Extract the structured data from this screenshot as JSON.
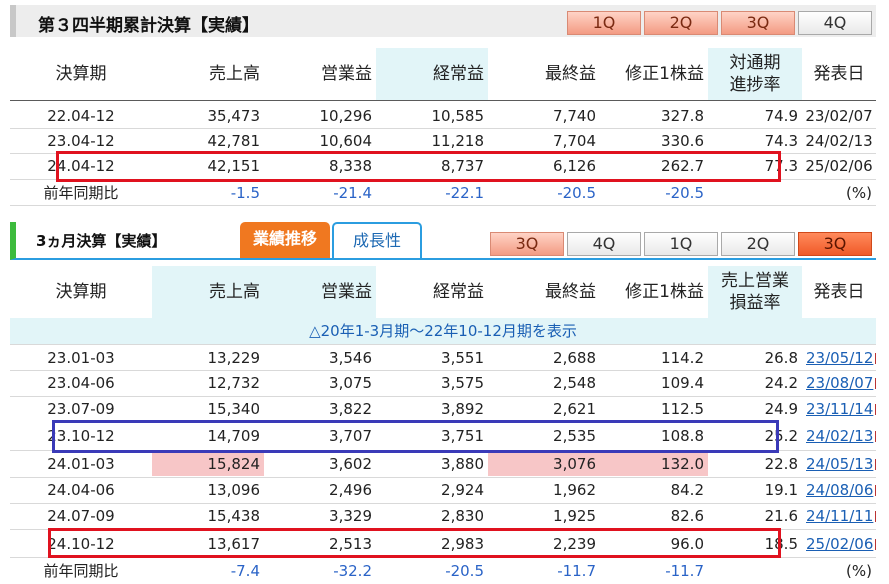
{
  "section1": {
    "title": "第３四半期累計決算【実績】",
    "tabs": [
      "1Q",
      "2Q",
      "3Q",
      "4Q"
    ],
    "headers": [
      "決算期",
      "売上高",
      "営業益",
      "経常益",
      "最終益",
      "修正1株益",
      "対通期\n進捗率",
      "発表日"
    ],
    "rows": [
      [
        "22.04-12",
        "35,473",
        "10,296",
        "10,585",
        "7,740",
        "327.8",
        "74.9",
        "23/02/07"
      ],
      [
        "23.04-12",
        "42,781",
        "10,604",
        "11,218",
        "7,704",
        "330.6",
        "74.3",
        "24/02/13"
      ],
      [
        "24.04-12",
        "42,151",
        "8,338",
        "8,737",
        "6,126",
        "262.7",
        "77.3",
        "25/02/06"
      ]
    ],
    "yoy": [
      "前年同期比",
      "-1.5",
      "-21.4",
      "-22.1",
      "-20.5",
      "-20.5",
      "",
      "(%)"
    ]
  },
  "section2": {
    "title": "3ヵ月決算【実績】",
    "subtabs": [
      "業績推移",
      "成長性"
    ],
    "tabs": [
      "3Q",
      "4Q",
      "1Q",
      "2Q",
      "3Q"
    ],
    "headers": [
      "決算期",
      "売上高",
      "営業益",
      "経常益",
      "最終益",
      "修正1株益",
      "売上営業\n損益率",
      "発表日"
    ],
    "note": "△20年1-3月期〜22年10-12月期を表示",
    "rows": [
      [
        "23.01-03",
        "13,229",
        "3,546",
        "3,551",
        "2,688",
        "114.2",
        "26.8",
        "23/05/12"
      ],
      [
        "23.04-06",
        "12,732",
        "3,075",
        "3,575",
        "2,548",
        "109.4",
        "24.2",
        "23/08/07"
      ],
      [
        "23.07-09",
        "15,340",
        "3,822",
        "3,892",
        "2,621",
        "112.5",
        "24.9",
        "23/11/14"
      ],
      [
        "23.10-12",
        "14,709",
        "3,707",
        "3,751",
        "2,535",
        "108.8",
        "25.2",
        "24/02/13"
      ],
      [
        "24.01-03",
        "15,824",
        "3,602",
        "3,880",
        "3,076",
        "132.0",
        "22.8",
        "24/05/13"
      ],
      [
        "24.04-06",
        "13,096",
        "2,496",
        "2,924",
        "1,962",
        "84.2",
        "19.1",
        "24/08/06"
      ],
      [
        "24.07-09",
        "15,438",
        "3,329",
        "2,830",
        "1,925",
        "82.6",
        "21.6",
        "24/11/11"
      ],
      [
        "24.10-12",
        "13,617",
        "2,513",
        "2,983",
        "2,239",
        "96.0",
        "18.5",
        "25/02/06"
      ]
    ],
    "yoy": [
      "前年同期比",
      "-7.4",
      "-32.2",
      "-20.5",
      "-11.7",
      "-11.7",
      "",
      "(%)"
    ]
  },
  "colors": {
    "highlight_col": "#e2f5f8",
    "pink": "#f7c6c7",
    "red_box": "#e0121f",
    "blue_box": "#3a3ab8",
    "negative": "#2a63c7",
    "active_tab": "#f05a28"
  }
}
